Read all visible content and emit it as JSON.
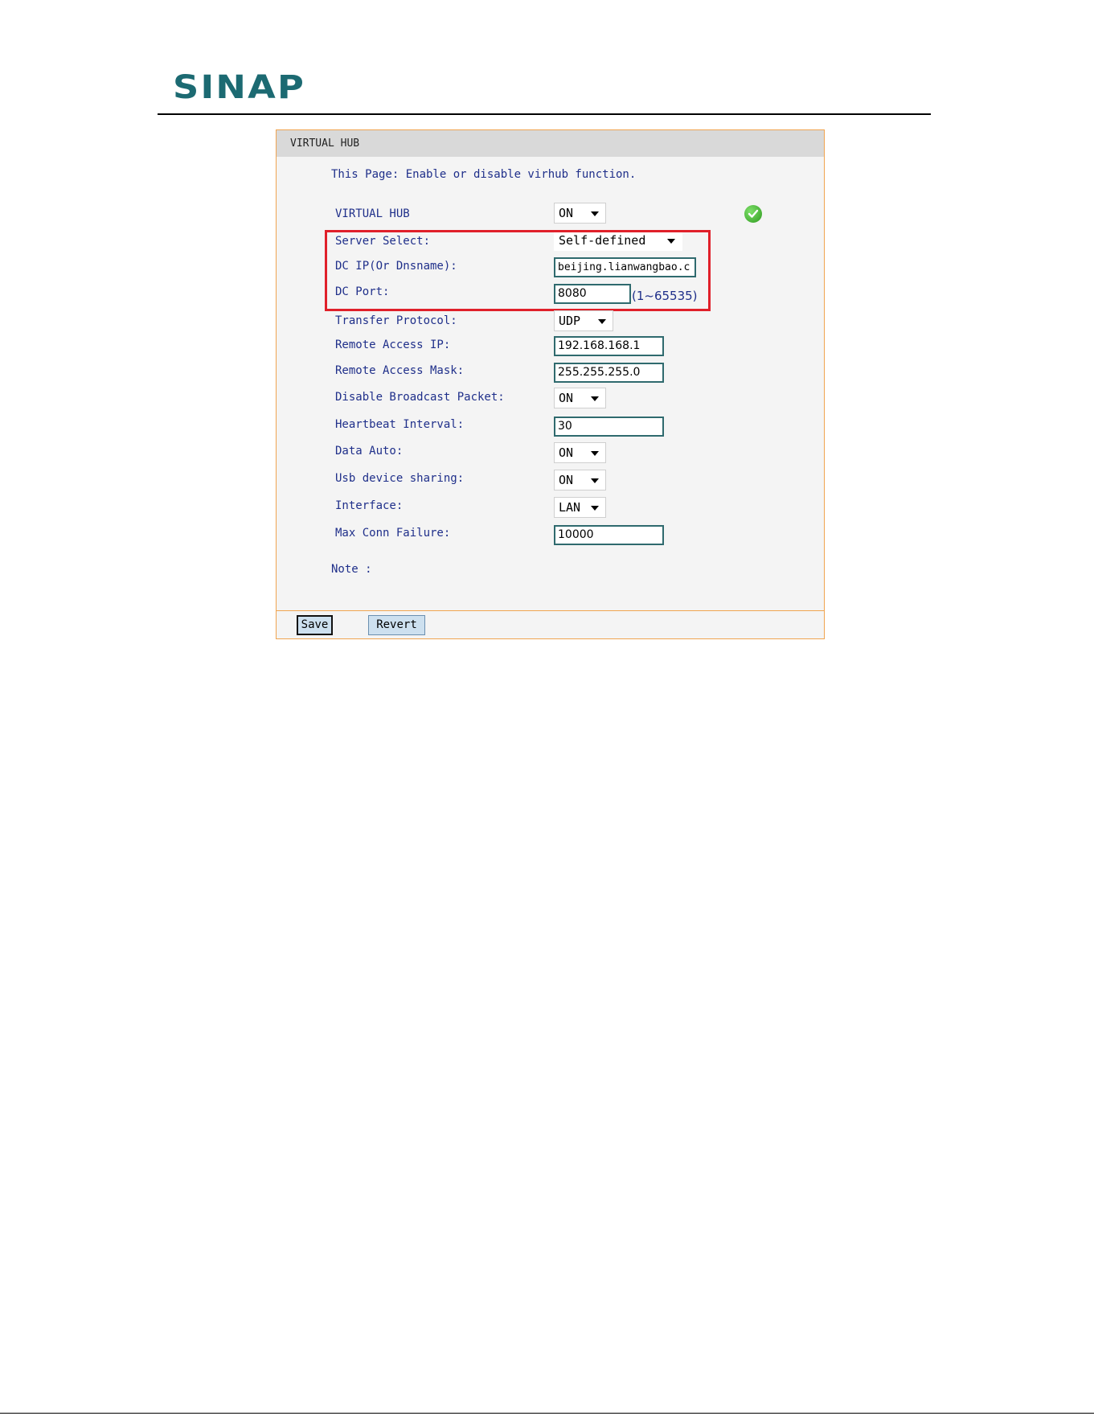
{
  "brand": {
    "logo_text": "SINAP"
  },
  "panel": {
    "title": "VIRTUAL HUB",
    "description": "This Page: Enable or disable virhub function.",
    "note_label": "Note :"
  },
  "fields": {
    "virtual_hub": {
      "label": "VIRTUAL HUB",
      "value": "ON"
    },
    "server_select": {
      "label": "Server Select:",
      "value": "Self-defined"
    },
    "dc_ip": {
      "label": "DC IP(Or Dnsname):",
      "value": "beijing.lianwangbao.c"
    },
    "dc_port": {
      "label": "DC Port:",
      "value": "8080",
      "range": "(1~65535)"
    },
    "transfer_protocol": {
      "label": "Transfer Protocol:",
      "value": "UDP"
    },
    "remote_access_ip": {
      "label": "Remote Access IP:",
      "value": "192.168.168.1"
    },
    "remote_access_mask": {
      "label": "Remote Access Mask:",
      "value": "255.255.255.0"
    },
    "disable_broadcast": {
      "label": "Disable Broadcast Packet:",
      "value": "ON"
    },
    "heartbeat_interval": {
      "label": "Heartbeat Interval:",
      "value": "30"
    },
    "data_auto": {
      "label": "Data Auto:",
      "value": "ON"
    },
    "usb_sharing": {
      "label": "Usb device sharing:",
      "value": "ON"
    },
    "interface": {
      "label": "Interface:",
      "value": "LAN"
    },
    "max_conn_failure": {
      "label": "Max Conn Failure:",
      "value": "10000"
    }
  },
  "buttons": {
    "save": "Save",
    "revert": "Revert"
  },
  "icons": {
    "status": "check-circle-icon"
  },
  "colors": {
    "label_text": "#1f2f8a",
    "highlight": "#e0202a",
    "panel_border": "#f0a450",
    "logo": "#1c6a72"
  }
}
